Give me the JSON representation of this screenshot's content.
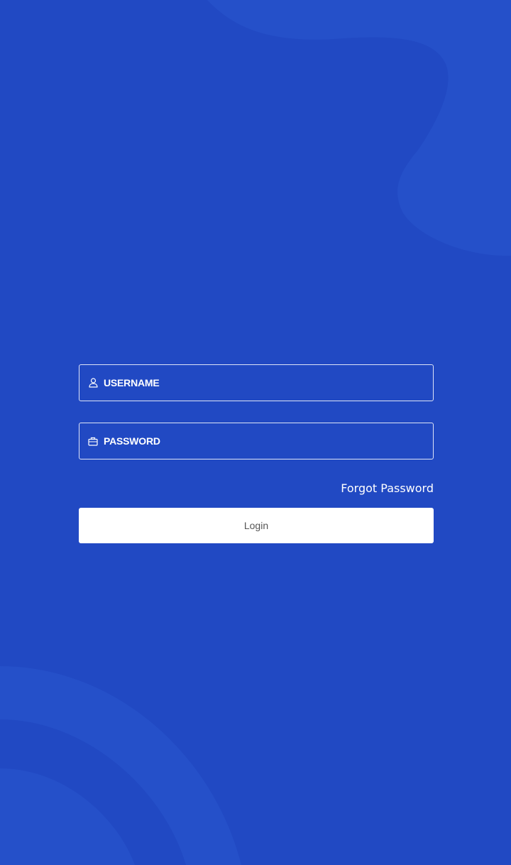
{
  "colors": {
    "background": "#2149c3",
    "blob": "#2550c9",
    "text": "#ffffff",
    "button_bg": "#ffffff",
    "button_text": "#555555"
  },
  "login_form": {
    "username": {
      "icon": "user-icon",
      "placeholder": "USERNAME",
      "value": ""
    },
    "password": {
      "icon": "briefcase-icon",
      "placeholder": "PASSWORD",
      "value": ""
    },
    "forgot_password_label": "Forgot Password",
    "login_label": "Login"
  }
}
